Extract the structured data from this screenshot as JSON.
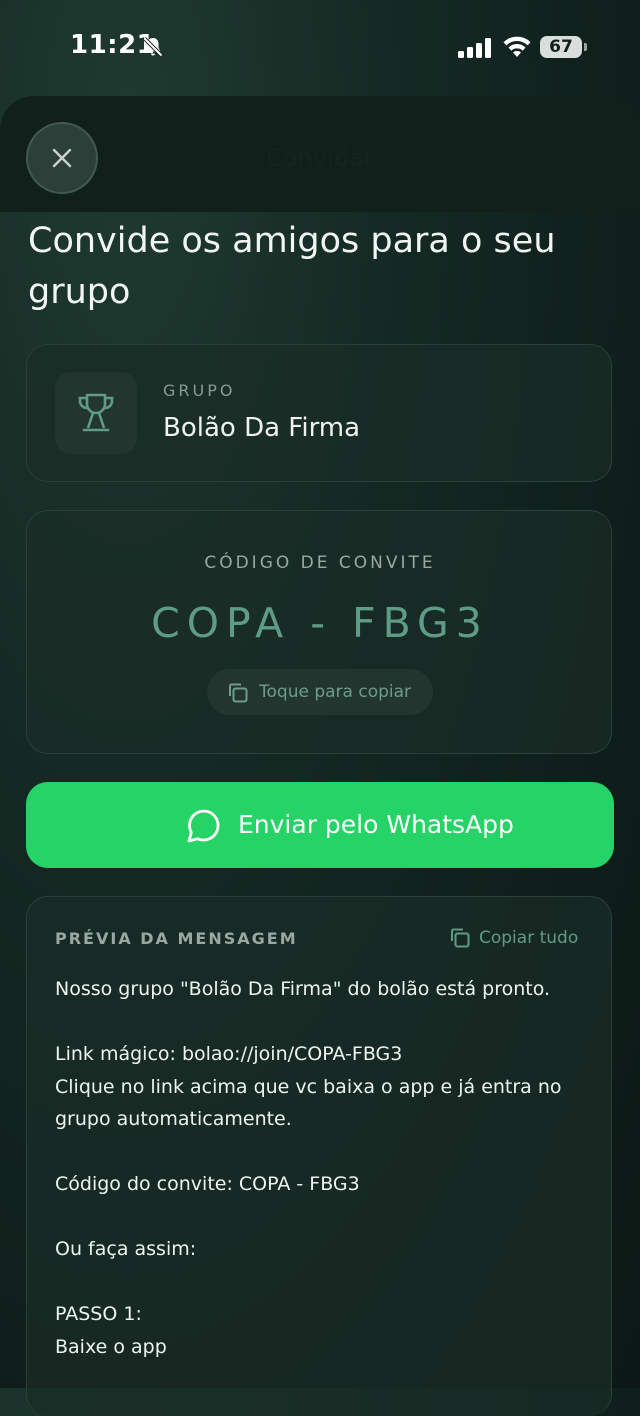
{
  "status_bar": {
    "time": "11:21",
    "battery": "67"
  },
  "sheet": {
    "title": "Convidar",
    "close_icon": "close-icon"
  },
  "heading": "Convide os amigos para o seu grupo",
  "group_card": {
    "label": "GRUPO",
    "name": "Bolão Da Firma",
    "icon": "trophy-icon"
  },
  "invite_card": {
    "label": "CÓDIGO DE CONVITE",
    "code": "COPA - FBG3",
    "copy_label": "Toque para copiar"
  },
  "whatsapp_button": {
    "label": "Enviar pelo WhatsApp"
  },
  "preview": {
    "label": "PRÉVIA DA MENSAGEM",
    "copy_all_label": "Copiar tudo",
    "lines": {
      "l1": "Nosso grupo \"Bolão Da Firma\" do bolão está pronto.",
      "l2": "Link mágico: bolao://join/COPA-FBG3",
      "l3": "Clique no link acima que vc baixa o app e já entra no grupo automaticamente.",
      "l4": "Código do convite: COPA - FBG3",
      "l5": "Ou faça assim:",
      "l6": "PASSO 1:",
      "l7": "Baixe o app"
    }
  },
  "colors": {
    "accent": "#25d366",
    "code": "#5e9c85",
    "background": "#0f1f1b"
  }
}
